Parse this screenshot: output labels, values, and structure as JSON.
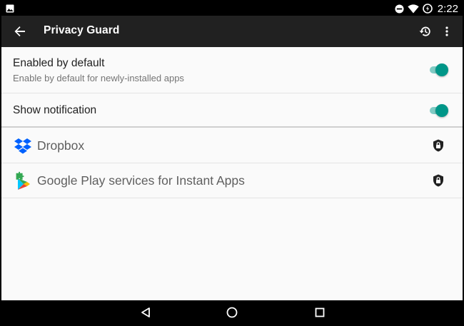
{
  "status_bar": {
    "time": "2:22",
    "left_icon": "image-notification-icon",
    "right_icons": [
      "do-not-disturb-icon",
      "wifi-icon",
      "battery-icon"
    ]
  },
  "app_bar": {
    "title": "Privacy Guard",
    "back_icon": "arrow-back-icon",
    "actions": [
      "history-icon",
      "more-vert-icon"
    ]
  },
  "settings": [
    {
      "title": "Enabled by default",
      "summary": "Enable by default for newly-installed apps",
      "checked": true
    },
    {
      "title": "Show notification",
      "checked": true
    }
  ],
  "apps": [
    {
      "name": "Dropbox",
      "icon": "dropbox-icon",
      "status_icon": "shield-icon"
    },
    {
      "name": "Google Play services for Instant Apps",
      "icon": "google-play-instant-icon",
      "status_icon": "shield-icon"
    }
  ],
  "colors": {
    "accent": "#009688",
    "accent_track": "#80cbc4",
    "app_bar": "#212121",
    "background": "#fafafa"
  },
  "nav_bar": [
    "nav-back-icon",
    "nav-home-icon",
    "nav-recents-icon"
  ]
}
